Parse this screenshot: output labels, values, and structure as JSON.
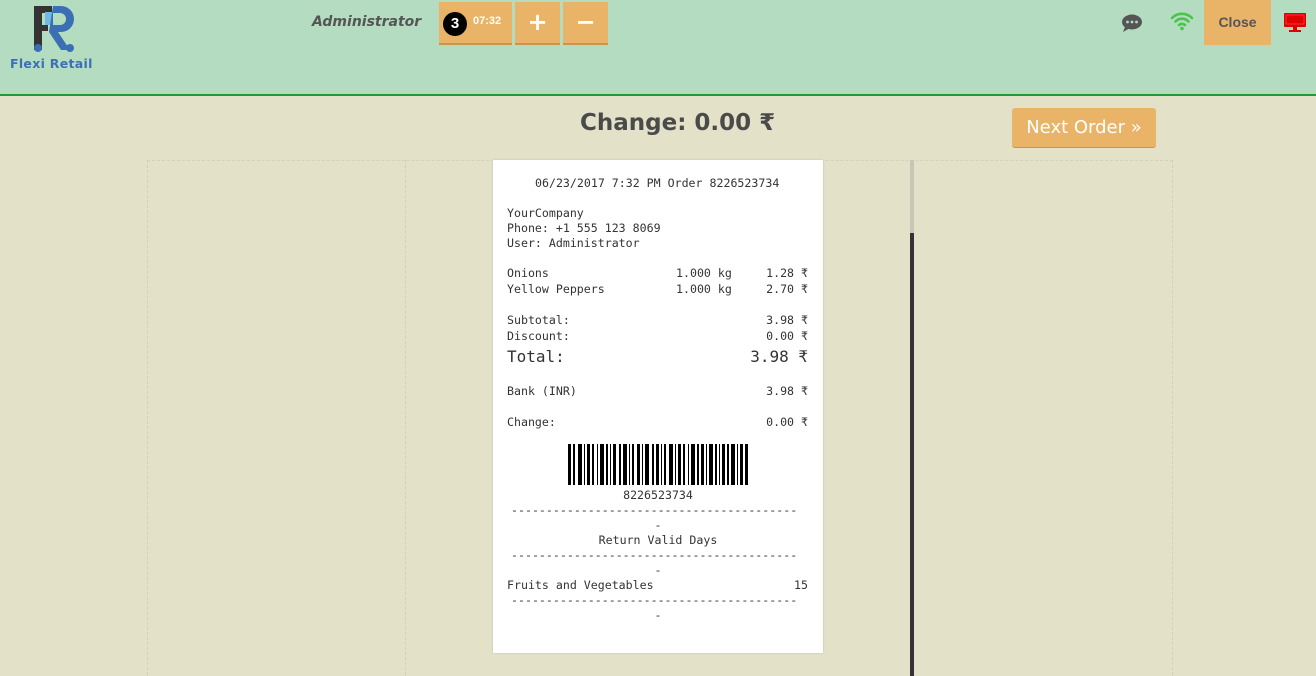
{
  "header": {
    "logo_text": "Flexi Retail",
    "user_name": "Administrator",
    "order_tab": {
      "number": "3",
      "time": "07:32"
    },
    "add_order_symbol": "+",
    "remove_order_symbol": "−",
    "close_label": "Close",
    "icons": [
      "chat-icon",
      "wifi-icon",
      "monitor-icon"
    ],
    "colors": {
      "bar": "#b3dcc0",
      "accent": "#eab468",
      "wifi": "#4cc44c",
      "monitor": "#e00000"
    }
  },
  "change_title": "Change: 0.00 ₹",
  "next_order_label": "Next Order »",
  "receipt": {
    "header_line": "06/23/2017 7:32 PM Order 8226523734",
    "company": "YourCompany",
    "phone": "Phone: +1 555 123 8069",
    "user": "User: Administrator",
    "lines": [
      {
        "name": "Onions",
        "qty": "1.000 kg",
        "price": "1.28 ₹"
      },
      {
        "name": "Yellow Peppers",
        "qty": "1.000 kg",
        "price": "2.70 ₹"
      }
    ],
    "subtotal_label": "Subtotal:",
    "subtotal_value": "3.98 ₹",
    "discount_label": "Discount:",
    "discount_value": "0.00 ₹",
    "total_label": "Total:",
    "total_value": "3.98 ₹",
    "payment_label": "Bank (INR)",
    "payment_value": "3.98 ₹",
    "change_label": "Change:",
    "change_value": "0.00 ₹",
    "barcode_number": "8226523734",
    "separator": "-----------------------------------------",
    "separator_tail": "-",
    "return_title": "Return Valid Days",
    "return_category": "Fruits and Vegetables",
    "return_days": "15"
  }
}
